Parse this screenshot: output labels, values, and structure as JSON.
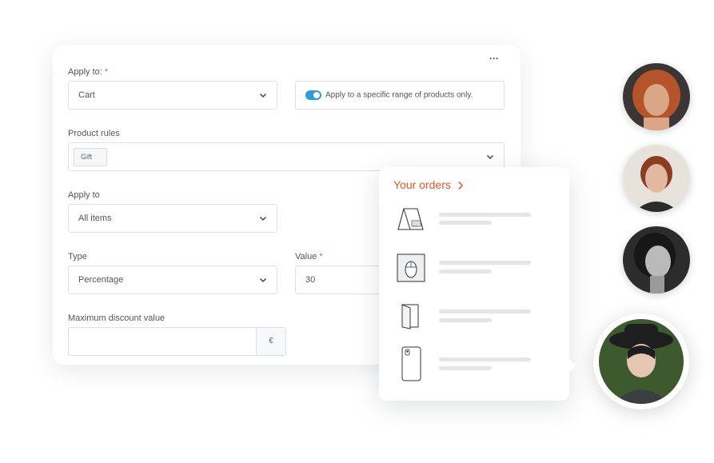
{
  "form": {
    "more_icon": "more-horizontal-icon",
    "apply_to": {
      "label": "Apply to:",
      "required_mark": "*",
      "value": "Cart"
    },
    "toggle": {
      "label": "Apply to a specific range of products only.",
      "state": "on",
      "color": "#2d9cdb"
    },
    "product_rules": {
      "label": "Product rules",
      "tag": "Gift"
    },
    "apply_to_items": {
      "label": "Apply to",
      "value": "All items"
    },
    "type": {
      "label": "Type",
      "value": "Percentage"
    },
    "value": {
      "label": "Value",
      "required_mark": "*",
      "value": "30"
    },
    "max_discount": {
      "label": "Maximum discount value",
      "value": "",
      "currency": "€"
    }
  },
  "orders_popup": {
    "title": "Your orders",
    "title_color": "#e0572b",
    "items": [
      {
        "icon": "calendar-icon"
      },
      {
        "icon": "mouse-icon"
      },
      {
        "icon": "folder-icon"
      },
      {
        "icon": "phone-case-icon"
      }
    ]
  },
  "avatars": [
    {
      "name": "avatar-1"
    },
    {
      "name": "avatar-2"
    },
    {
      "name": "avatar-3"
    },
    {
      "name": "avatar-4-active"
    }
  ]
}
